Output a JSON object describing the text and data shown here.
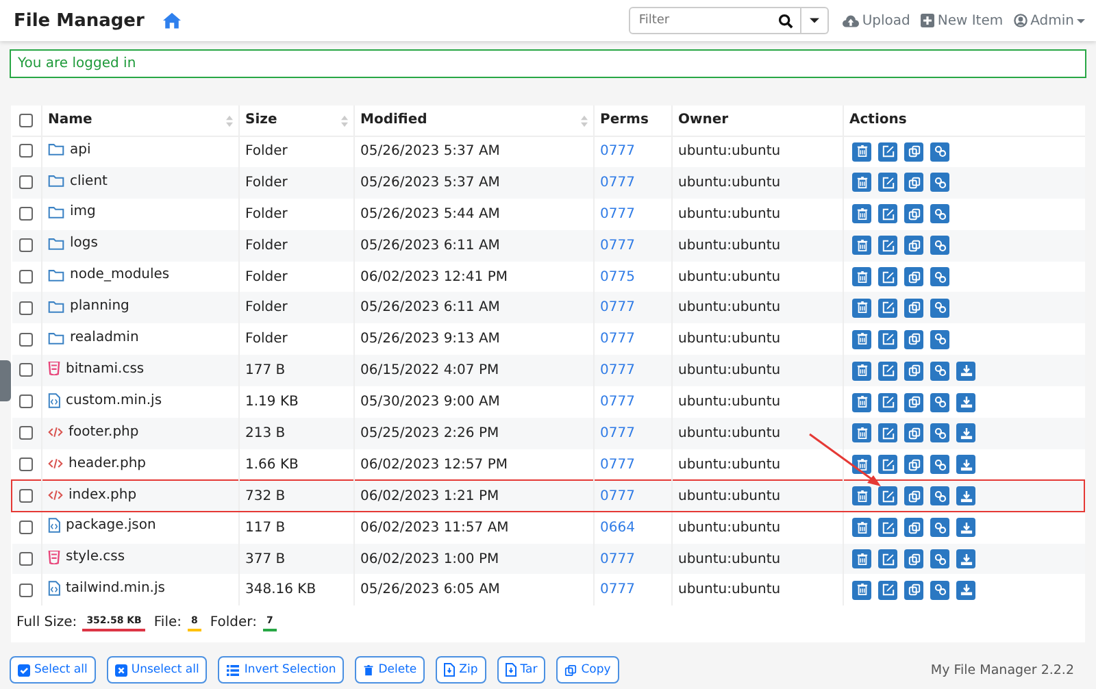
{
  "navbar": {
    "title": "File Manager",
    "filter": {
      "placeholder": "Filter"
    },
    "links": [
      {
        "kind": "upload",
        "label": "Upload"
      },
      {
        "kind": "new",
        "label": "New Item"
      },
      {
        "kind": "user",
        "label": "Admin"
      }
    ]
  },
  "alert": "You are logged in",
  "table": {
    "all_checked": false,
    "columns": [
      {
        "label": "Name",
        "sortable": true
      },
      {
        "label": "Size",
        "sortable": true
      },
      {
        "label": "Modified",
        "sortable": true
      },
      {
        "label": "Perms",
        "sortable": false
      },
      {
        "label": "Owner",
        "sortable": false
      },
      {
        "label": "Actions",
        "sortable": false
      }
    ],
    "rows": [
      {
        "kind": "folder",
        "name": "api",
        "size": "Folder",
        "modified": "05/26/2023 5:37 AM",
        "perms": "0777",
        "owner": "ubuntu:ubuntu",
        "checked": false,
        "highlighted": false
      },
      {
        "kind": "folder",
        "name": "client",
        "size": "Folder",
        "modified": "05/26/2023 5:37 AM",
        "perms": "0777",
        "owner": "ubuntu:ubuntu",
        "checked": false,
        "highlighted": false
      },
      {
        "kind": "folder",
        "name": "img",
        "size": "Folder",
        "modified": "05/26/2023 5:44 AM",
        "perms": "0777",
        "owner": "ubuntu:ubuntu",
        "checked": false,
        "highlighted": false
      },
      {
        "kind": "folder",
        "name": "logs",
        "size": "Folder",
        "modified": "05/26/2023 6:11 AM",
        "perms": "0777",
        "owner": "ubuntu:ubuntu",
        "checked": false,
        "highlighted": false
      },
      {
        "kind": "folder",
        "name": "node_modules",
        "size": "Folder",
        "modified": "06/02/2023 12:41 PM",
        "perms": "0775",
        "owner": "ubuntu:ubuntu",
        "checked": false,
        "highlighted": false
      },
      {
        "kind": "folder",
        "name": "planning",
        "size": "Folder",
        "modified": "05/26/2023 6:11 AM",
        "perms": "0777",
        "owner": "ubuntu:ubuntu",
        "checked": false,
        "highlighted": false
      },
      {
        "kind": "folder",
        "name": "realadmin",
        "size": "Folder",
        "modified": "05/26/2023 9:13 AM",
        "perms": "0777",
        "owner": "ubuntu:ubuntu",
        "checked": false,
        "highlighted": false
      },
      {
        "kind": "css",
        "name": "bitnami.css",
        "size": "177 B",
        "modified": "06/15/2022 4:07 PM",
        "perms": "0777",
        "owner": "ubuntu:ubuntu",
        "checked": false,
        "highlighted": false
      },
      {
        "kind": "js",
        "name": "custom.min.js",
        "size": "1.19 KB",
        "modified": "05/30/2023 9:00 AM",
        "perms": "0777",
        "owner": "ubuntu:ubuntu",
        "checked": false,
        "highlighted": false
      },
      {
        "kind": "php",
        "name": "footer.php",
        "size": "213 B",
        "modified": "05/25/2023 2:26 PM",
        "perms": "0777",
        "owner": "ubuntu:ubuntu",
        "checked": false,
        "highlighted": false
      },
      {
        "kind": "php",
        "name": "header.php",
        "size": "1.66 KB",
        "modified": "06/02/2023 12:57 PM",
        "perms": "0777",
        "owner": "ubuntu:ubuntu",
        "checked": false,
        "highlighted": false
      },
      {
        "kind": "php",
        "name": "index.php",
        "size": "732 B",
        "modified": "06/02/2023 1:21 PM",
        "perms": "0777",
        "owner": "ubuntu:ubuntu",
        "checked": false,
        "highlighted": true
      },
      {
        "kind": "js",
        "name": "package.json",
        "size": "117 B",
        "modified": "06/02/2023 11:57 AM",
        "perms": "0664",
        "owner": "ubuntu:ubuntu",
        "checked": false,
        "highlighted": false
      },
      {
        "kind": "css",
        "name": "style.css",
        "size": "377 B",
        "modified": "06/02/2023 1:00 PM",
        "perms": "0777",
        "owner": "ubuntu:ubuntu",
        "checked": false,
        "highlighted": false
      },
      {
        "kind": "js",
        "name": "tailwind.min.js",
        "size": "348.16 KB",
        "modified": "05/26/2023 6:05 AM",
        "perms": "0777",
        "owner": "ubuntu:ubuntu",
        "checked": false,
        "highlighted": false
      }
    ],
    "summary": [
      {
        "label": "Full Size:",
        "value": "352.58 KB",
        "color": "#dc3545"
      },
      {
        "label": "File:",
        "value": "8",
        "color": "#ffc107"
      },
      {
        "label": "Folder:",
        "value": "7",
        "color": "#28a745"
      }
    ]
  },
  "buttons": [
    {
      "kind": "check",
      "label": "Select all"
    },
    {
      "kind": "uncheck",
      "label": "Unselect all"
    },
    {
      "kind": "list",
      "label": "Invert Selection"
    },
    {
      "kind": "trash",
      "label": "Delete"
    },
    {
      "kind": "file",
      "label": "Zip"
    },
    {
      "kind": "file",
      "label": "Tar"
    },
    {
      "kind": "copy",
      "label": "Copy"
    }
  ],
  "version": "My File Manager 2.2.2"
}
